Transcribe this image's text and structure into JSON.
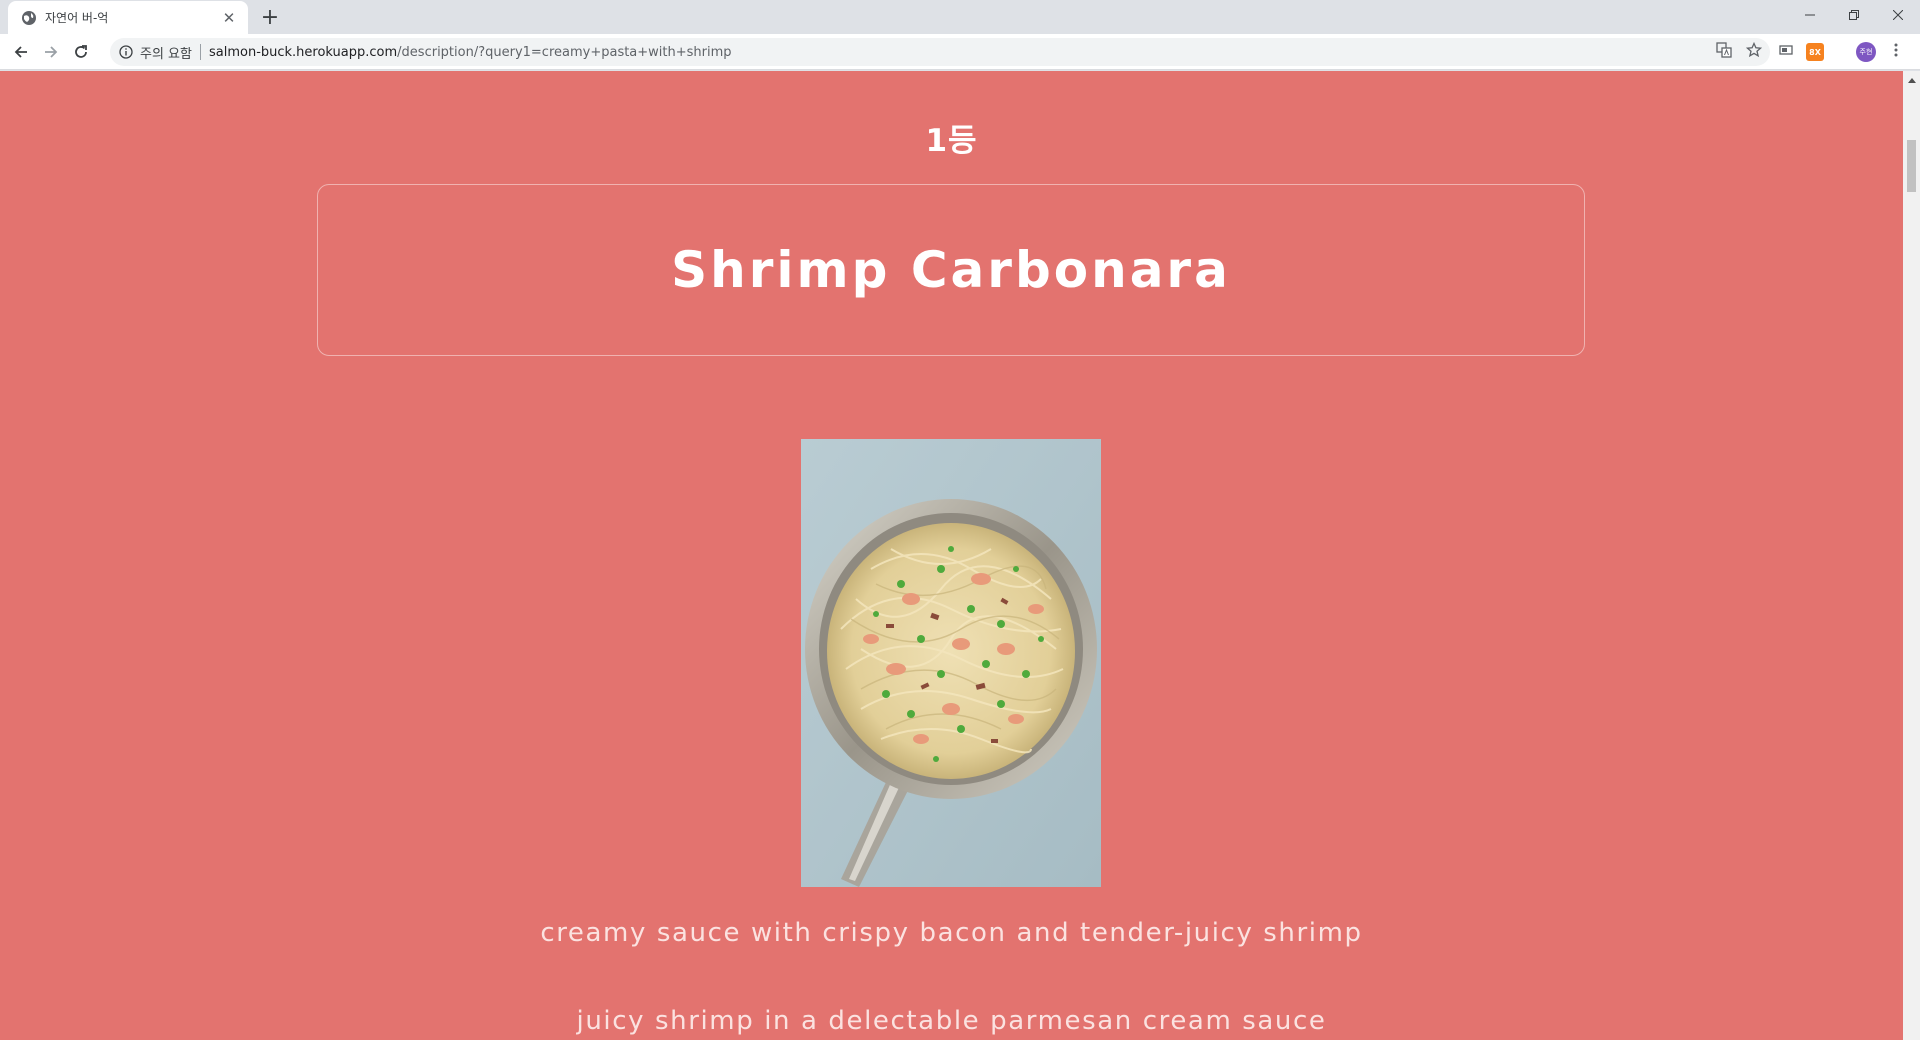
{
  "browser": {
    "tab_title": "자연어 버-억",
    "new_tab_symbol": "+",
    "security_label": "주의 요함",
    "url_host": "salmon-buck.herokuapp.com",
    "url_path": "/description/?query1=creamy+pasta+with+shrimp",
    "extension_badge": "8X",
    "profile_initials": "주현"
  },
  "page": {
    "background_color": "#e3736f",
    "rank": "1등",
    "title": "Shrimp Carbonara",
    "descriptions": [
      "creamy sauce with crispy bacon and tender-juicy shrimp",
      "juicy shrimp in a delectable parmesan cream sauce"
    ]
  }
}
